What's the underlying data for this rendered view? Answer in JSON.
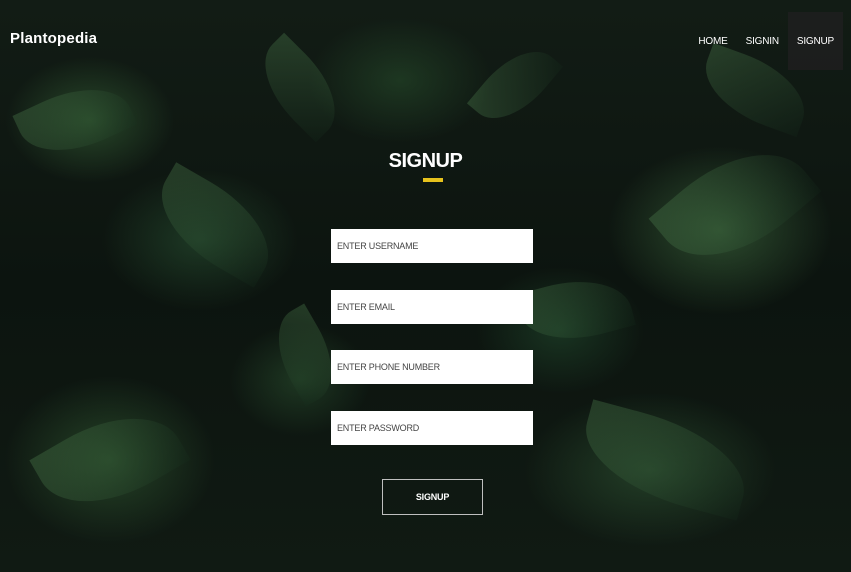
{
  "header": {
    "brand": "Plantopedia",
    "nav": [
      {
        "label": "HOME"
      },
      {
        "label": "SIGNIN"
      },
      {
        "label": "SIGNUP"
      }
    ]
  },
  "form": {
    "title": "SIGNUP",
    "username_placeholder": "ENTER USERNAME",
    "email_placeholder": "ENTER EMAIL",
    "phone_placeholder": "ENTER PHONE NUMBER",
    "password_placeholder": "ENTER PASSWORD",
    "submit_label": "SIGNUP"
  },
  "colors": {
    "accent": "#e6c21d",
    "active_nav_bg": "#1e1e1e"
  }
}
